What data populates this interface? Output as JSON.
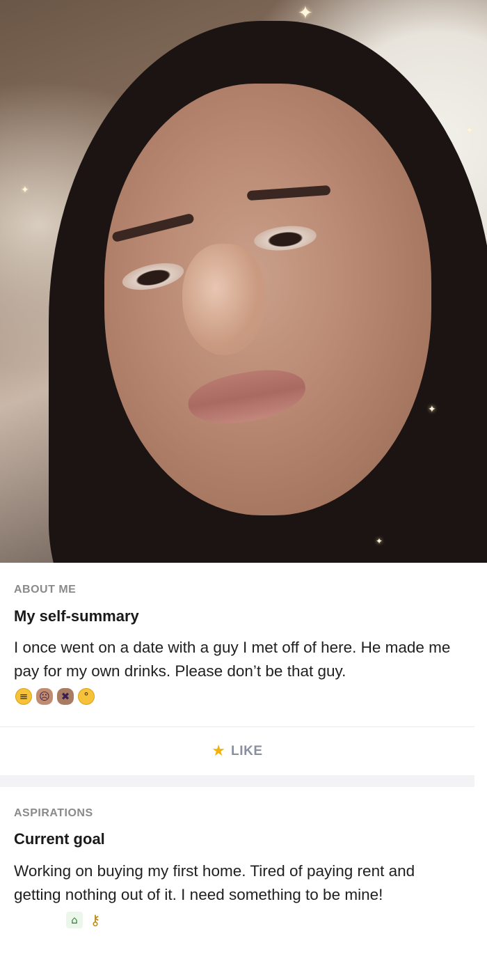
{
  "about": {
    "section_label": "ABOUT ME",
    "title": "My self-summary",
    "text": "I once went on a date with a guy I met off of here. He made me pay for my own drinks. Please don’t be that guy.",
    "emojis": [
      "expressionless-face",
      "person-facepalming",
      "person-gesturing-no",
      "face-with-rolling-eyes"
    ]
  },
  "like": {
    "label": "LIKE",
    "icon": "star-icon",
    "icon_color": "#f1b20a"
  },
  "aspirations": {
    "section_label": "ASPIRATIONS",
    "title": "Current goal",
    "text": "Working on buying my first home. Tired of paying rent and getting nothing out of it. I need something to be mine!",
    "emojis": [
      "house-with-garden",
      "key"
    ]
  }
}
